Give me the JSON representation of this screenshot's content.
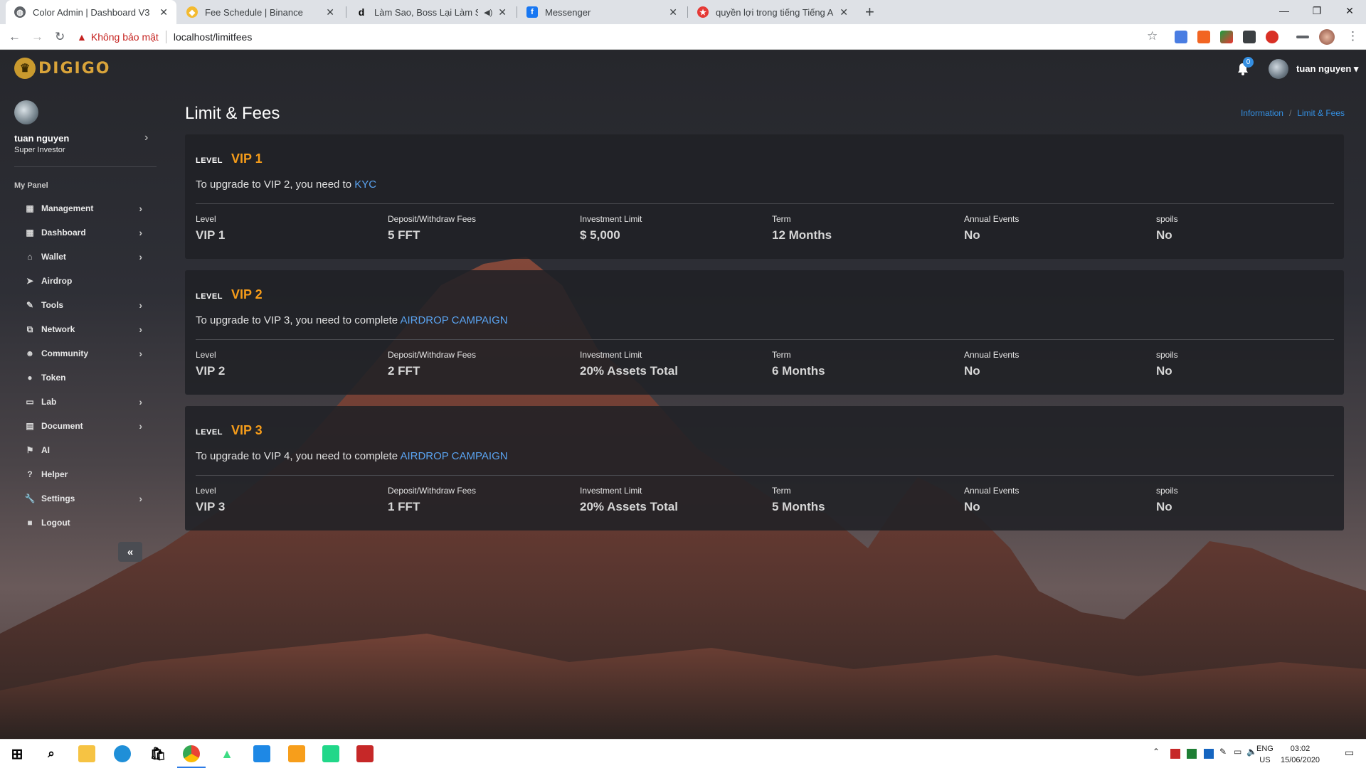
{
  "browser": {
    "tabs": [
      {
        "title": "Color Admin | Dashboard V3",
        "active": true,
        "icon": "globe-icon"
      },
      {
        "title": "Fee Schedule | Binance",
        "active": false,
        "icon": "binance-icon"
      },
      {
        "title": "Làm Sao, Boss Lại Làm Sao N",
        "active": false,
        "icon": "d-site-icon"
      },
      {
        "title": "Messenger",
        "active": false,
        "icon": "facebook-icon"
      },
      {
        "title": "quyền lợi trong tiếng Tiếng Anh",
        "active": false,
        "icon": "translate-icon"
      }
    ],
    "security_label": "Không bảo mật",
    "url": "localhost/limitfees"
  },
  "app": {
    "brand": "DIGIGO",
    "notifications_count": "0",
    "user_name": "tuan nguyen"
  },
  "sidebar": {
    "name": "tuan nguyen",
    "role": "Super Investor",
    "section_title": "My Panel",
    "items": [
      {
        "label": "Management",
        "icon": "grid-icon",
        "has_arrow": true
      },
      {
        "label": "Dashboard",
        "icon": "grid-icon",
        "has_arrow": true
      },
      {
        "label": "Wallet",
        "icon": "bank-icon",
        "has_arrow": true
      },
      {
        "label": "Airdrop",
        "icon": "paper-plane-icon",
        "has_arrow": false
      },
      {
        "label": "Tools",
        "icon": "pencil-icon",
        "has_arrow": true
      },
      {
        "label": "Network",
        "icon": "sitemap-icon",
        "has_arrow": true
      },
      {
        "label": "Community",
        "icon": "users-icon",
        "has_arrow": true
      },
      {
        "label": "Token",
        "icon": "coin-icon",
        "has_arrow": false
      },
      {
        "label": "Lab",
        "icon": "laptop-icon",
        "has_arrow": true
      },
      {
        "label": "Document",
        "icon": "document-icon",
        "has_arrow": true
      },
      {
        "label": "AI",
        "icon": "flag-icon",
        "has_arrow": false
      },
      {
        "label": "Helper",
        "icon": "question-icon",
        "has_arrow": false
      },
      {
        "label": "Settings",
        "icon": "wrench-icon",
        "has_arrow": true
      },
      {
        "label": "Logout",
        "icon": "square-icon",
        "has_arrow": false
      }
    ]
  },
  "content": {
    "title": "Limit & Fees",
    "breadcrumb": [
      "Information",
      "Limit & Fees"
    ],
    "level_word": "LEVEL",
    "columns": [
      "Level",
      "Deposit/Withdraw Fees",
      "Investment Limit",
      "Term",
      "Annual Events",
      "spoils"
    ],
    "levels": [
      {
        "name": "VIP 1",
        "upgrade_text": "To upgrade to VIP 2, you need to ",
        "upgrade_link": "KYC",
        "values": [
          "VIP 1",
          "5 FFT",
          "$ 5,000",
          "12 Months",
          "No",
          "No"
        ]
      },
      {
        "name": "VIP 2",
        "upgrade_text": "To upgrade to VIP 3, you need to complete ",
        "upgrade_link": "AIRDROP CAMPAIGN",
        "values": [
          "VIP 2",
          "2 FFT",
          "20% Assets Total",
          "6 Months",
          "No",
          "No"
        ]
      },
      {
        "name": "VIP 3",
        "upgrade_text": "To upgrade to VIP 4, you need to complete ",
        "upgrade_link": "AIRDROP CAMPAIGN",
        "values": [
          "VIP 3",
          "1 FFT",
          "20% Assets Total",
          "5 Months",
          "No",
          "No"
        ]
      }
    ]
  },
  "taskbar": {
    "lang_line1": "ENG",
    "lang_line2": "US",
    "time": "03:02",
    "date": "15/06/2020"
  },
  "colors": {
    "accent_orange": "#f59c1a",
    "link_blue": "#348fe2"
  }
}
